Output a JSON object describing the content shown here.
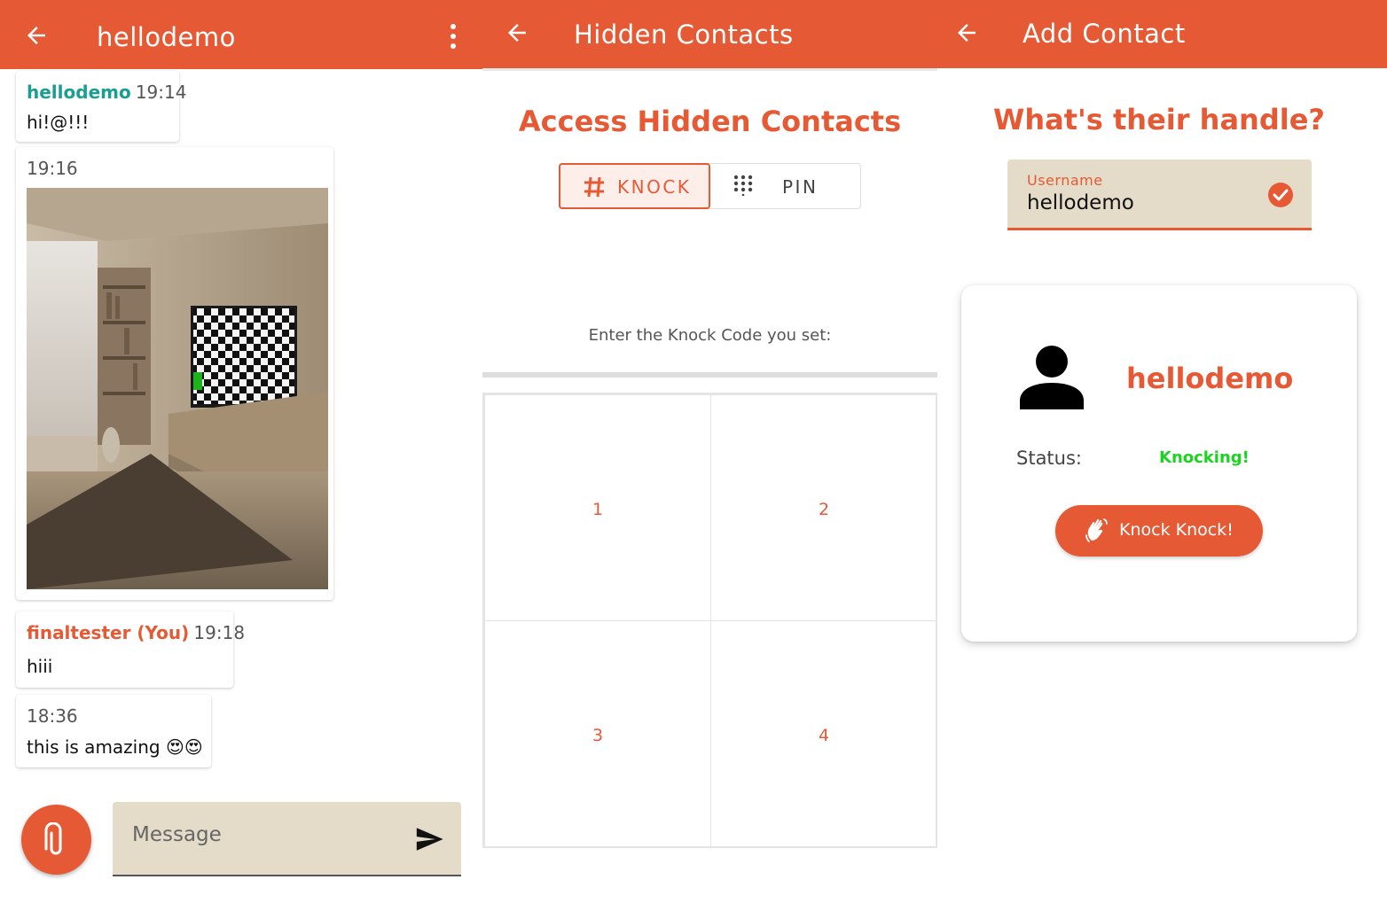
{
  "theme": {
    "accent": "#e55a35",
    "teal": "#1a9e91",
    "status_green": "#1bd420",
    "field_bg": "#e4dcc8"
  },
  "chat": {
    "title": "hellodemo",
    "messages": [
      {
        "sender": "hellodemo",
        "time": "19:14",
        "text": "hi!@!!!"
      },
      {
        "time": "19:16",
        "image": "living-room-photo"
      },
      {
        "sender": "finaltester (You)",
        "time": "19:18",
        "text": "hiii"
      },
      {
        "time": "18:36",
        "text": "this is amazing",
        "emoji": "😍😍"
      }
    ],
    "composer": {
      "placeholder": "Message"
    }
  },
  "hidden": {
    "title": "Hidden Contacts",
    "heading": "Access Hidden Contacts",
    "toggle": {
      "knock_label": "KNOCK",
      "pin_label": "PIN",
      "selected": "KNOCK"
    },
    "prompt": "Enter the Knock Code you set:",
    "cells": [
      "1",
      "2",
      "3",
      "4"
    ]
  },
  "add": {
    "title": "Add Contact",
    "heading": "What's their handle?",
    "field": {
      "label": "Username",
      "value": "hellodemo"
    },
    "card": {
      "name": "hellodemo",
      "status_label": "Status:",
      "status_value": "Knocking!",
      "button_label": "Knock Knock!"
    }
  }
}
